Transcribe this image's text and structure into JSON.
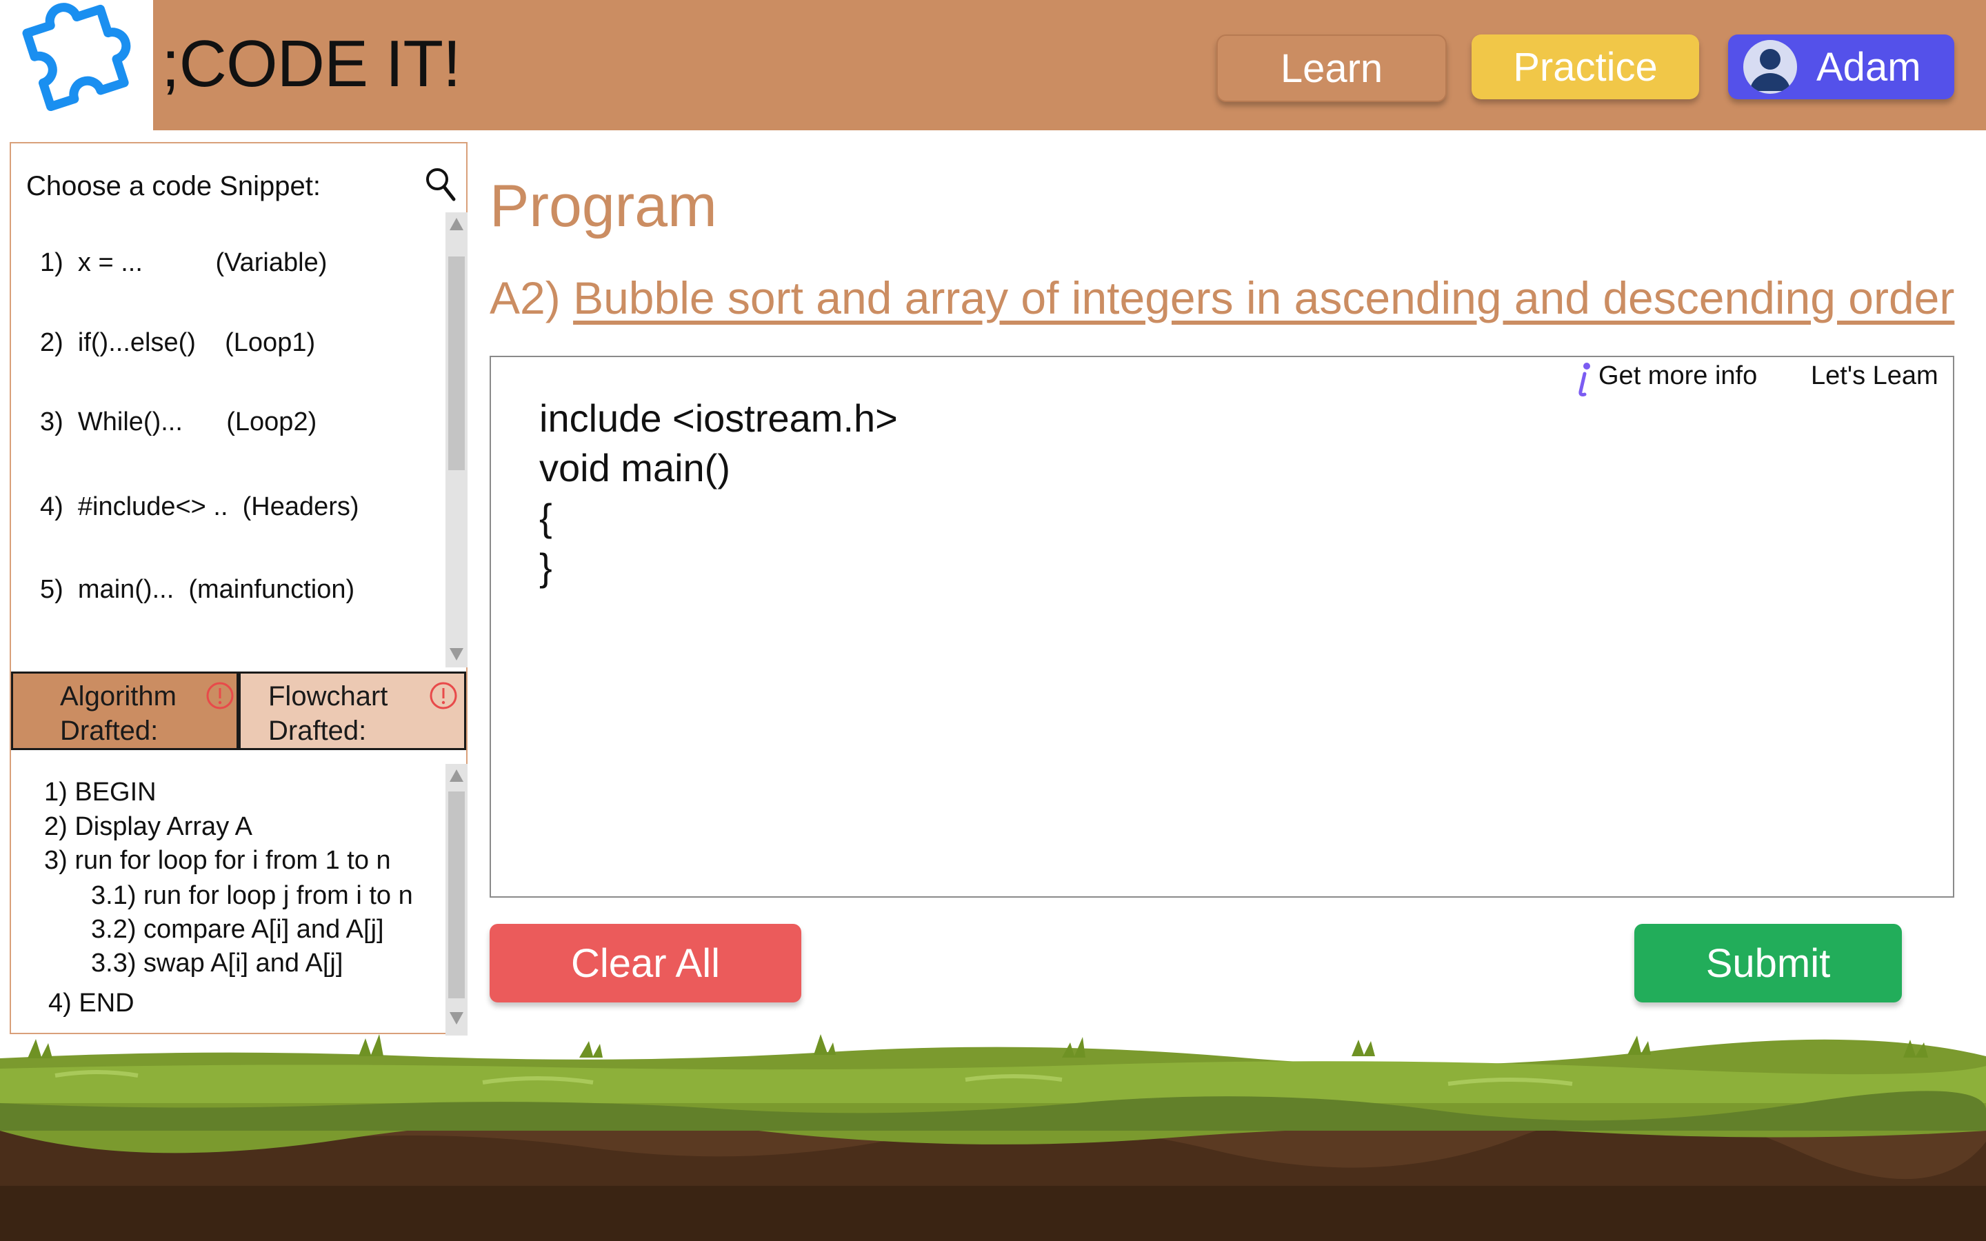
{
  "header": {
    "brand": ";CODE IT!",
    "nav": {
      "learn": "Learn",
      "practice": "Practice",
      "user": "Adam"
    }
  },
  "snippets": {
    "title": "Choose a code Snippet:",
    "items": [
      {
        "label": "1)  x = ...          (Variable)"
      },
      {
        "label": "2)  if()...else()    (Loop1)"
      },
      {
        "label": "3)  While()...      (Loop2)"
      },
      {
        "label": "4)  #include<> ..  (Headers)"
      },
      {
        "label": "5)  main()...  (mainfunction)"
      }
    ]
  },
  "drafts": {
    "algorithm_tab": [
      "Algorithm",
      "Drafted:"
    ],
    "flowchart_tab": [
      "Flowchart",
      "Drafted:"
    ],
    "algorithm_lines": [
      "1) BEGIN",
      "2) Display Array A",
      "3) run for loop for i from 1 to n",
      "3.1) run for loop j from i to n",
      "3.2) compare A[i] and A[j]",
      "3.3) swap A[i] and A[j]",
      "4) END"
    ]
  },
  "main": {
    "heading": "Program",
    "task_prefix": "A2)",
    "task_title": "Bubble sort and array of integers in ascending and descending order",
    "editor": {
      "info_link": "Get more info",
      "learn_link": "Let's Leam",
      "code": [
        "include <iostream.h>",
        "void main()",
        "{",
        "}"
      ]
    },
    "actions": {
      "clear": "Clear All",
      "submit": "Submit"
    }
  },
  "colors": {
    "brand_brown": "#cb8d62",
    "practice_yellow": "#f1c748",
    "user_blue": "#5451ea",
    "clear_red": "#eb5b5b",
    "submit_green": "#22ad5a",
    "logo_blue": "#1a8ff0"
  },
  "icons": {
    "logo": "puzzle-piece-icon",
    "user": "user-avatar-icon",
    "search": "search-icon",
    "warning": "exclamation-circle-icon",
    "info": "info-icon"
  }
}
